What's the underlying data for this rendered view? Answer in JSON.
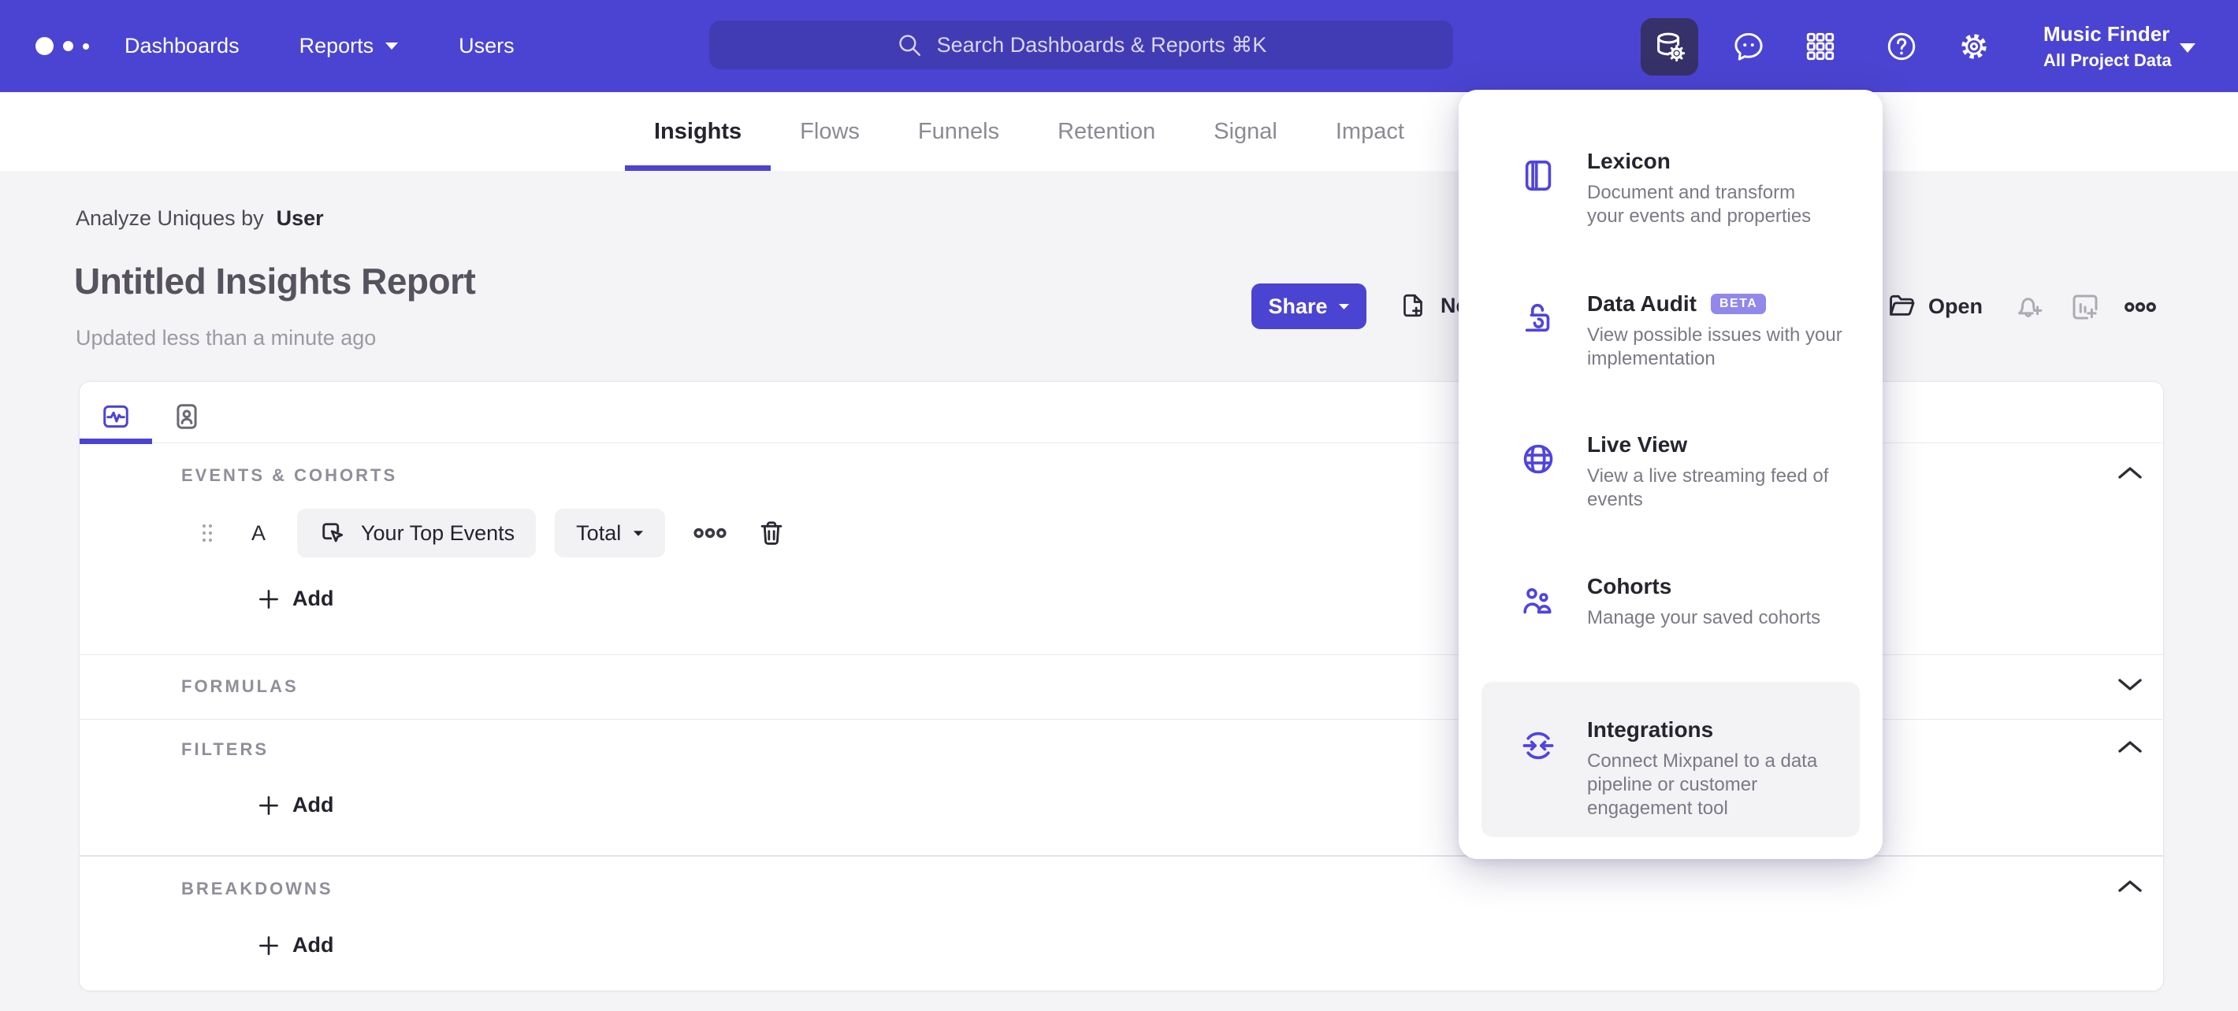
{
  "nav": {
    "items": [
      {
        "label": "Dashboards"
      },
      {
        "label": "Reports"
      },
      {
        "label": "Users"
      }
    ],
    "search_placeholder": "Search Dashboards & Reports ⌘K",
    "project_name": "Music Finder",
    "project_scope": "All Project Data"
  },
  "tabs": [
    {
      "label": "Insights"
    },
    {
      "label": "Flows"
    },
    {
      "label": "Funnels"
    },
    {
      "label": "Retention"
    },
    {
      "label": "Signal"
    },
    {
      "label": "Impact"
    }
  ],
  "report": {
    "analyze_prefix": "Analyze Uniques by",
    "analyze_entity": "User",
    "title": "Untitled Insights Report",
    "updated": "Updated less than a minute ago",
    "share_label": "Share",
    "new_label": "New",
    "open_label": "Open"
  },
  "builder": {
    "sections": {
      "events": "EVENTS & COHORTS",
      "formulas": "FORMULAS",
      "filters": "FILTERS",
      "breakdowns": "BREAKDOWNS"
    },
    "event_row": {
      "letter": "A",
      "event_name": "Your Top Events",
      "metric": "Total"
    },
    "add_label": "Add"
  },
  "menu": {
    "items": [
      {
        "title": "Lexicon",
        "desc": "Document and transform\nyour events and properties"
      },
      {
        "title": "Data Audit",
        "badge": "BETA",
        "desc": "View possible issues with your\nimplementation"
      },
      {
        "title": "Live View",
        "desc": "View a live streaming feed of\nevents"
      },
      {
        "title": "Cohorts",
        "desc": "Manage your saved cohorts"
      },
      {
        "title": "Integrations",
        "desc": "Connect Mixpanel to a data\npipeline or customer\nengagement tool"
      }
    ]
  },
  "colors": {
    "nav_purple": "#4B44D2",
    "search_field": "#423CB4",
    "active_nav_button": "#363169",
    "accent_purple": "#4B44D2",
    "menu_icon_purple": "#4F44E0",
    "badge_purple": "#9287EA",
    "page_background": "#F4F4F6"
  }
}
